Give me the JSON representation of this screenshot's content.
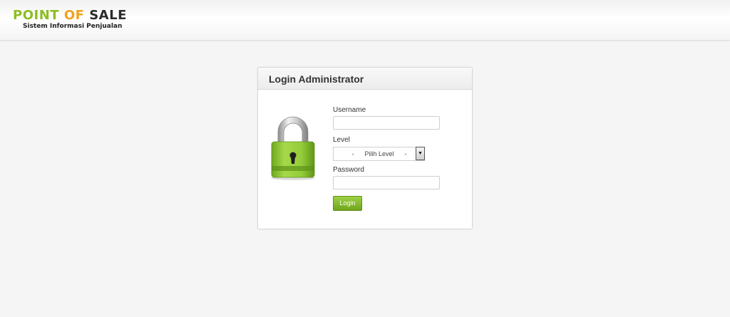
{
  "brand": {
    "word1": "POINT",
    "word2": "OF",
    "word3": "SALE",
    "subtitle": "Sistem Informasi Penjualan",
    "colors": {
      "word1": "#8cbe21",
      "word2": "#f0a21c",
      "word3": "#2b2b2b"
    }
  },
  "login": {
    "title": "Login Administrator",
    "username_label": "Username",
    "username_value": "",
    "level_label": "Level",
    "level_selected": "-      Pilih Level      -",
    "password_label": "Password",
    "password_value": "",
    "button_label": "Login",
    "lock_icon": "padlock-icon",
    "accent": "#8cbe21"
  }
}
